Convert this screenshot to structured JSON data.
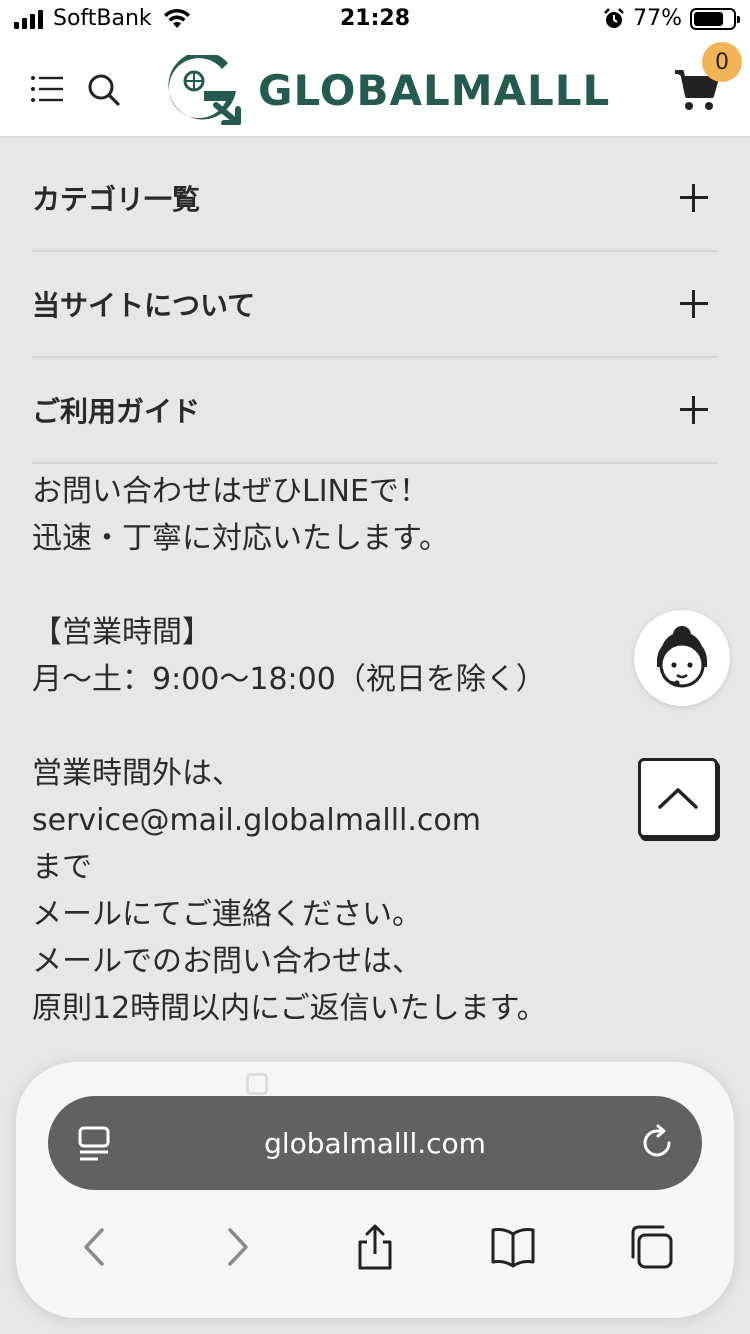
{
  "status_bar": {
    "carrier": "SoftBank",
    "time": "21:28",
    "battery": "77%",
    "battery_level": 0.77
  },
  "header": {
    "logo_text": "GLOBALMALLL",
    "cart_count": "0",
    "brand_color": "#245b50",
    "badge_color": "#f1b457"
  },
  "accordion": [
    {
      "title": "カテゴリ一覧"
    },
    {
      "title": "当サイトについて"
    },
    {
      "title": "ご利用ガイド"
    }
  ],
  "contact": {
    "line1": "お問い合わせはぜひLINEで！",
    "line2": "迅速・丁寧に対応いたします。",
    "hours_heading": "【営業時間】",
    "hours": "月〜土：9:00〜18:00（祝日を除く）",
    "after_hours": "営業時間外は、",
    "email": "service@mail.globalmalll.com",
    "made": "まで",
    "mail_contact": "メールにてご連絡ください。",
    "mail_reply_1": "メールでのお問い合わせは、",
    "mail_reply_2": "原則12時間以内にご返信いたします。"
  },
  "browser": {
    "url": "globalmalll.com",
    "icons": [
      "reader-icon",
      "reload-icon",
      "back-icon",
      "forward-icon",
      "share-icon",
      "bookmarks-icon",
      "tabs-icon"
    ]
  }
}
